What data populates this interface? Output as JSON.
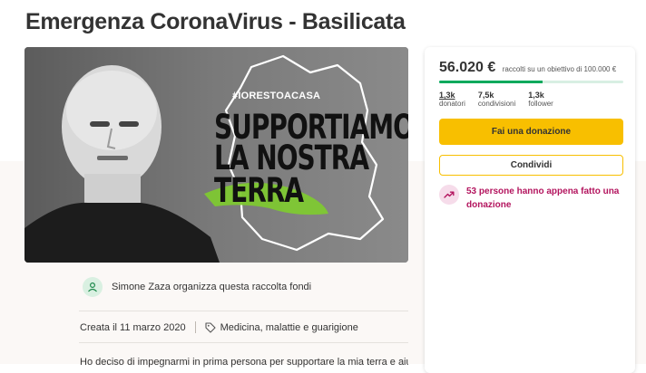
{
  "page": {
    "title": "Emergenza CoronaVirus - Basilicata"
  },
  "hero": {
    "hashtag": "#IORESTOACASA",
    "line1": "SUPPORTIAMO",
    "line2": "LA NOSTRA",
    "line3": "TERRA"
  },
  "organizer": {
    "text": "Simone Zaza organizza questa raccolta fondi"
  },
  "meta": {
    "created": "Creata il 11 marzo 2020",
    "category": "Medicina, malattie e guarigione"
  },
  "description": {
    "text": "Ho deciso di impegnarmi in prima persona per supportare la mia terra e aiutare gli"
  },
  "card": {
    "amount": "56.020 €",
    "goal": "raccolti su un obiettivo di 100.000 €",
    "progress_fraction": 0.5602,
    "stats": [
      {
        "value": "1,3k",
        "label": "donatori"
      },
      {
        "value": "7,5k",
        "label": "condivisioni"
      },
      {
        "value": "1,3k",
        "label": "follower"
      }
    ],
    "donate_label": "Fai una donazione",
    "share_label": "Condividi",
    "recent_donations": "53 persone hanno appena fatto una donazione"
  },
  "colors": {
    "accent_green": "#02a95c",
    "donate_yellow": "#f8bf00",
    "recent_magenta": "#b3145e"
  }
}
